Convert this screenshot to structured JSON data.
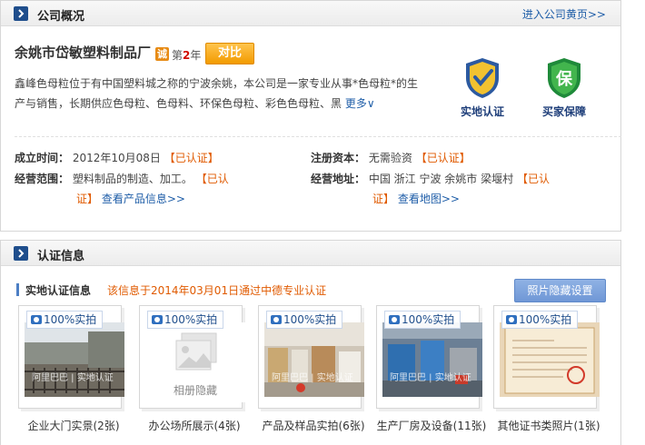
{
  "overview": {
    "title": "公司概况",
    "enter_home": "进入公司黄页>>",
    "company_name": "余姚市岱敏塑料制品厂",
    "cheng_badge": "诚",
    "year_prefix": "第",
    "year_num": "2",
    "year_suffix": "年",
    "compare_label": "对比",
    "description": "鑫峰色母粒位于有中国塑料城之称的宁波余姚，本公司是一家专业从事*色母粒*的生产与销售，长期供应色母粒、色母料、环保色母粒、彩色色母粒、黑",
    "more_label": "更多∨",
    "badges": [
      {
        "label": "实地认证",
        "icon": "verified-shield"
      },
      {
        "label": "买家保障",
        "icon": "buyer-protection-shield",
        "glyph": "保"
      }
    ],
    "fields": {
      "established": {
        "label": "成立时间：",
        "value": "2012年10月08日",
        "cert": "已认证"
      },
      "capital": {
        "label": "注册资本：",
        "value": "无需验资",
        "cert": "已认证"
      },
      "scope": {
        "label": "经营范围：",
        "value": "塑料制品的制造、加工。",
        "cert_a": "已认",
        "cert_b": "证",
        "link": "查看产品信息>>"
      },
      "address": {
        "label": "经营地址：",
        "value": "中国 浙江 宁波 余姚市 梁堰村",
        "cert_a": "已认",
        "cert_b": "证",
        "link": "查看地图>>"
      }
    },
    "bracket_open": "【",
    "bracket_close": "】"
  },
  "cert": {
    "title": "认证信息",
    "sub_title": "实地认证信息",
    "note": "该信息于2014年03月01日通过中德专业认证",
    "photo_setting_label": "照片隐藏设置",
    "real_tag": "100%实拍",
    "watermark": "阿里巴巴 | 实地认证",
    "hidden_label": "相册隐藏",
    "albums": [
      {
        "caption": "企业大门实景(2张)"
      },
      {
        "caption": "办公场所展示(4张)"
      },
      {
        "caption": "产品及样品实拍(6张)"
      },
      {
        "caption": "生产厂房及设备(11张)"
      },
      {
        "caption": "其他证书类照片(1张)"
      }
    ]
  },
  "colors": {
    "link_blue": "#1f5ea8",
    "certified_orange": "#e05a00",
    "compare_btn": "#f29b00",
    "setting_btn": "#7aa1da"
  }
}
